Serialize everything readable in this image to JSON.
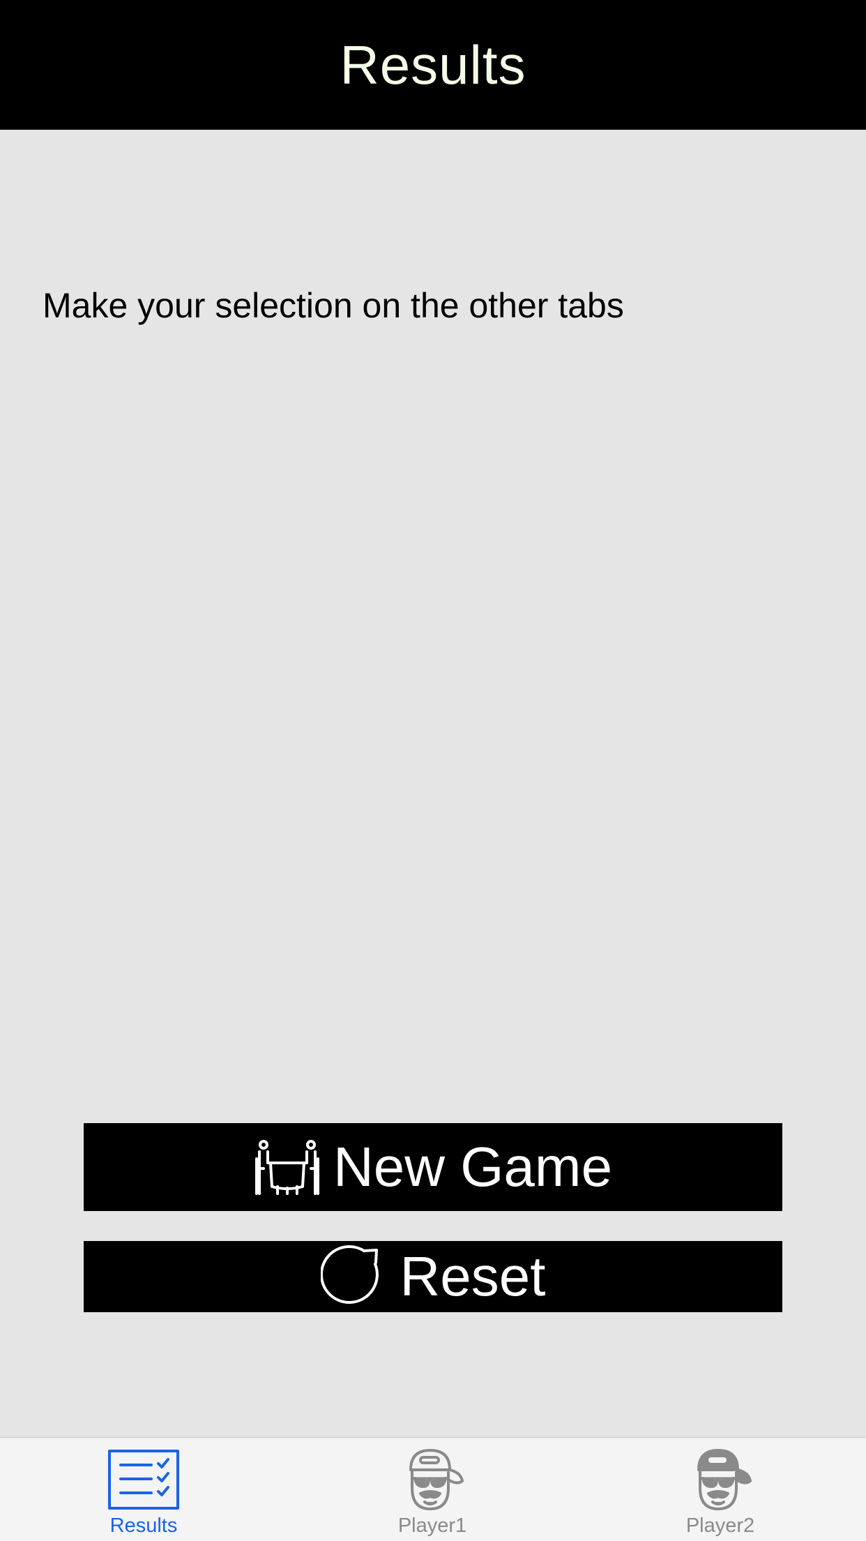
{
  "header": {
    "title": "Results"
  },
  "main": {
    "instruction": "Make your selection on the other tabs"
  },
  "buttons": {
    "new_game": {
      "label": "New Game",
      "icon": "players-at-table-icon"
    },
    "reset": {
      "label": "Reset",
      "icon": "refresh-icon"
    }
  },
  "tab_bar": {
    "tabs": [
      {
        "label": "Results",
        "icon": "checklist-icon",
        "selected": true
      },
      {
        "label": "Player1",
        "icon": "player-cap-icon",
        "selected": false
      },
      {
        "label": "Player2",
        "icon": "player-cap-icon",
        "selected": false
      }
    ]
  },
  "colors": {
    "nav_background": "#000000",
    "nav_title": "#f4fde8",
    "content_background": "#e5e5e5",
    "button_background": "#000000",
    "button_text": "#ffffff",
    "tab_active": "#1a63e8",
    "tab_inactive": "#8a8a8a"
  }
}
